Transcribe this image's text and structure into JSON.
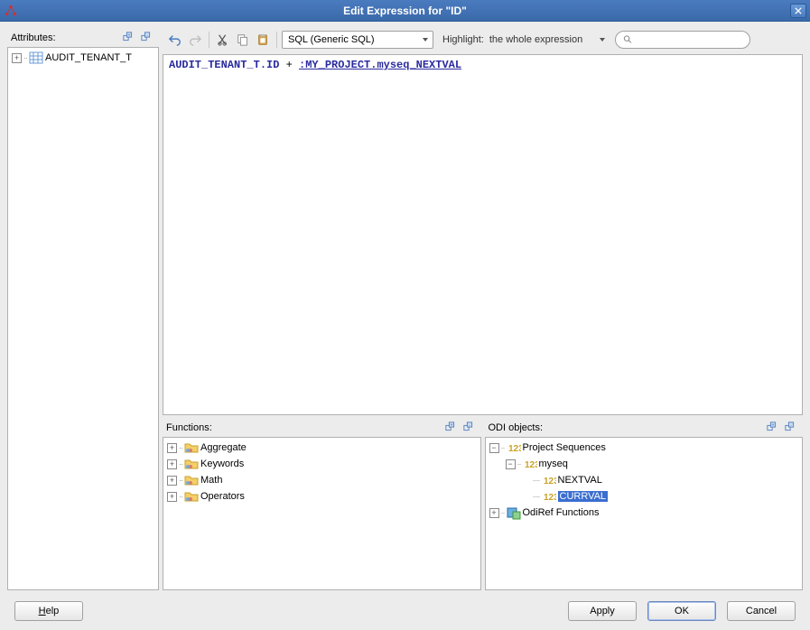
{
  "titlebar": {
    "title": "Edit Expression for \"ID\""
  },
  "attributes": {
    "label": "Attributes:",
    "items": [
      {
        "label": "AUDIT_TENANT_T"
      }
    ]
  },
  "toolbar": {
    "sql_dropdown": "SQL (Generic SQL)",
    "highlight_prefix": "Highlight:",
    "highlight_value": "the whole expression",
    "search_placeholder": ""
  },
  "editor": {
    "col": "AUDIT_TENANT_T.ID",
    "op": " + ",
    "seq": ":MY_PROJECT.myseq_NEXTVAL"
  },
  "functions": {
    "label": "Functions:",
    "items": [
      {
        "label": "Aggregate"
      },
      {
        "label": "Keywords"
      },
      {
        "label": "Math"
      },
      {
        "label": "Operators"
      }
    ]
  },
  "odi": {
    "label": "ODI objects:",
    "root": "Project Sequences",
    "seq": "myseq",
    "children": [
      "NEXTVAL",
      "CURRVAL"
    ],
    "selected": "CURRVAL",
    "odiref": "OdiRef Functions"
  },
  "buttons": {
    "help": "Help",
    "apply": "Apply",
    "ok": "OK",
    "cancel": "Cancel"
  }
}
